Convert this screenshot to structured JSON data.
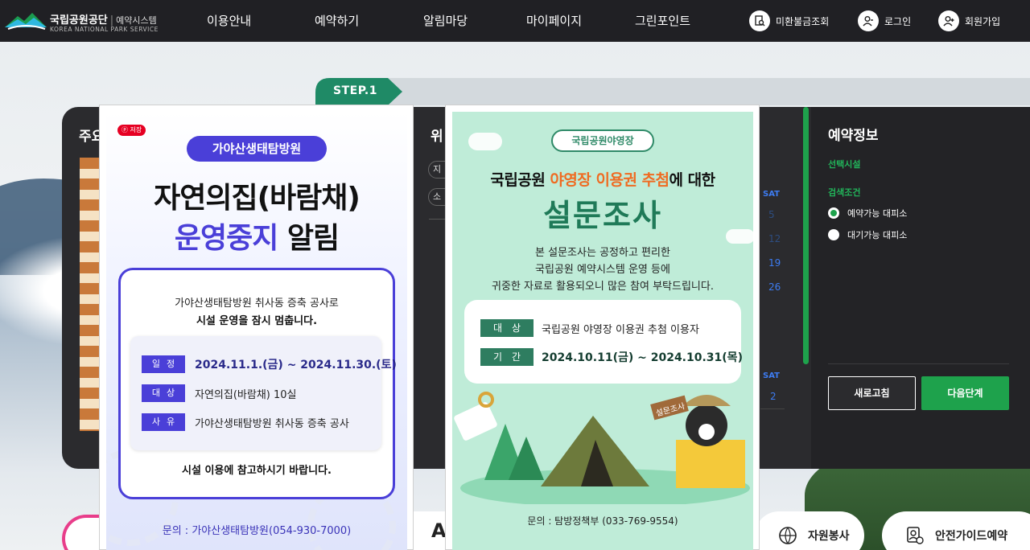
{
  "header": {
    "logo_title": "국립공원공단",
    "logo_sub": "예약시스템",
    "logo_en": "KOREA NATIONAL PARK SERVICE",
    "nav": [
      "이용안내",
      "예약하기",
      "알림마당",
      "마이페이지",
      "그린포인트"
    ],
    "util": {
      "refund": "미환불금조회",
      "login": "로그인",
      "signup": "회원가입"
    }
  },
  "step": {
    "label": "STEP.1"
  },
  "panel": {
    "left_title": "주요",
    "mid_title": "위",
    "mid_chips": [
      "지",
      "소"
    ],
    "calendar": {
      "sat_label": "SAT",
      "week1": [
        "5",
        "12",
        "19",
        "26"
      ],
      "week2": [
        "2"
      ]
    }
  },
  "sidebar": {
    "title": "예약정보",
    "selected_facility_label": "선택시설",
    "search_condition_label": "검색조건",
    "radio_options": [
      {
        "label": "예약가능 대피소",
        "checked": true
      },
      {
        "label": "대기가능 대피소",
        "checked": false
      }
    ],
    "refresh_button": "새로고침",
    "next_button": "다음단계"
  },
  "popup1": {
    "save_badge": "저장",
    "pill": "가야산생태탐방원",
    "headline1": "자연의집(바람채)",
    "headline2_accent": "운영중지",
    "headline2_rest": "알림",
    "text1": "가야산생태탐방원 취사동 증축 공사로",
    "text2": "시설 운영을 잠시 멈춥니다.",
    "rows": [
      {
        "label": "일정",
        "value": "2024.11.1.(금) ~ 2024.11.30.(토)"
      },
      {
        "label": "대상",
        "value": "자연의집(바람채) 10실"
      },
      {
        "label": "사유",
        "value": "가야산생태탐방원 취사동 증축 공사"
      }
    ],
    "note": "시설 이용에 참고하시기 바랍니다.",
    "contact": "문의 : 가야산생태탐방원(054-930-7000)"
  },
  "popup2": {
    "tag": "국립공원야영장",
    "headline1_a": "국립공원 ",
    "headline1_accent": "야영장 이용권 추첨",
    "headline1_b": "에 대한",
    "headline2": "설문조사",
    "desc": [
      "본 설문조사는 공정하고 편리한",
      "국립공원 예약시스템 운영 등에",
      "귀중한 자료로 활용되오니 많은 참여 부탁드립니다."
    ],
    "rows": [
      {
        "label": "대상",
        "value": "국립공원 야영장 이용권 추첨 이용자"
      },
      {
        "label": "기간",
        "value": "2024.10.11(금) ~ 2024.10.31(목)"
      }
    ],
    "sign": "설문조사",
    "contact": "문의 : 탐방정책부 (033-769-9554)"
  },
  "quick_links": {
    "partial": "AS",
    "volunteer": "자원봉사",
    "safety_guide": "안전가이드예약"
  },
  "colors": {
    "header_bg": "#202024",
    "accent_green": "#1ea24c",
    "popup1_accent": "#4a3fd8",
    "popup2_accent": "#2e7d60",
    "popup2_orange": "#ef6b22"
  }
}
